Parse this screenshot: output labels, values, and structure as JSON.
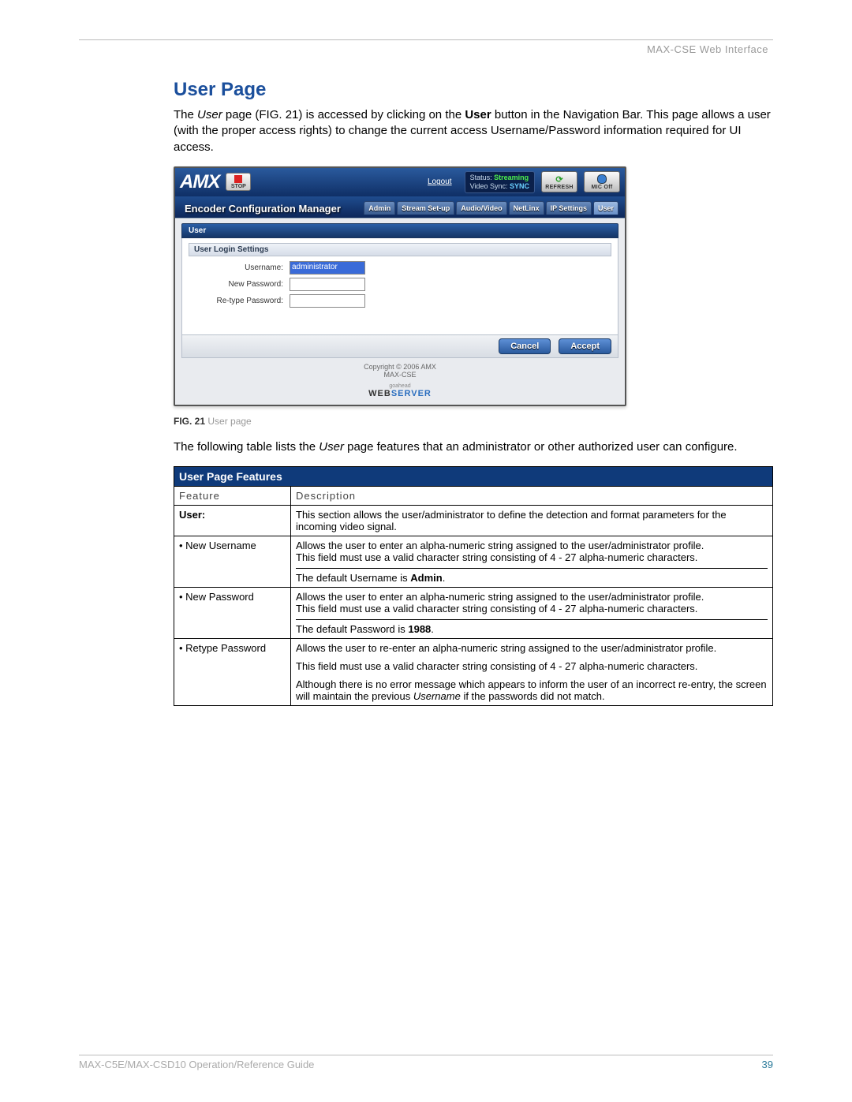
{
  "header": {
    "breadcrumb": "MAX-CSE Web Interface"
  },
  "section": {
    "title": "User Page",
    "intro_a": "The ",
    "intro_user_italic": "User",
    "intro_b": " page (FIG. 21) is accessed by clicking on the ",
    "intro_user_bold": "User",
    "intro_c": " button in the Navigation Bar. This page allows a user (with the proper access rights) to change the current access Username/Password information required for UI access."
  },
  "app": {
    "logo_text": "AMX",
    "stop_label": "STOP",
    "logout": "Logout",
    "status_label": "Status:",
    "status_value": "Streaming",
    "sync_label": "Video Sync:",
    "sync_value": "SYNC",
    "refresh_label": "REFRESH",
    "mic_label": "MIC Off",
    "manager_title": "Encoder Configuration Manager",
    "tabs": [
      "Admin",
      "Stream Set-up",
      "Audio/Video",
      "NetLinx",
      "IP Settings",
      "User"
    ],
    "active_tab_index": 5,
    "panel_title": "User",
    "subpanel_title": "User Login Settings",
    "form": {
      "username_label": "Username:",
      "username_value": "administrator",
      "newpass_label": "New Password:",
      "newpass_value": "",
      "retype_label": "Re-type Password:",
      "retype_value": ""
    },
    "cancel_btn": "Cancel",
    "accept_btn": "Accept",
    "copyright": "Copyright © 2006 AMX",
    "product": "MAX-CSE",
    "go_label": "goahead",
    "web_label": "WEB",
    "server_label": "SERVER"
  },
  "figure": {
    "num": "FIG. 21",
    "caption": "User page"
  },
  "para2_a": "The following table lists the ",
  "para2_user_italic": "User",
  "para2_b": " page features that an administrator or other authorized user can configure.",
  "table": {
    "title": "User Page Features",
    "head_feature": "Feature",
    "head_desc": "Description",
    "rows": [
      {
        "feature": "User:",
        "feature_bold": true,
        "desc_lines": [
          "This section allows the user/administrator to define the detection and format parameters for the incoming video signal."
        ]
      },
      {
        "feature": "• New Username",
        "desc_lines": [
          "Allows the user to enter an alpha-numeric string assigned to the user/administrator profile.",
          "This field must use a valid character string consisting of 4 - 27 alpha-numeric characters."
        ],
        "note_prefix": "The default Username is ",
        "note_bold": "Admin",
        "note_suffix": "."
      },
      {
        "feature": "• New Password",
        "desc_lines": [
          "Allows the user to enter an alpha-numeric string assigned to the user/administrator profile.",
          "This field must use a valid character string consisting of 4 - 27 alpha-numeric characters."
        ],
        "note_prefix": "The default Password is ",
        "note_bold": "1988",
        "note_suffix": "."
      },
      {
        "feature": "• Retype Password",
        "desc_lines": [
          "Allows the user to re-enter an alpha-numeric string assigned to the user/administrator profile.",
          "This field must use a valid character string consisting of 4 - 27 alpha-numeric characters."
        ],
        "extra_prefix": "Although there is no error message which appears to inform the user of an incorrect re-entry, the screen will maintain the previous ",
        "extra_italic": "Username",
        "extra_suffix": " if the passwords did not match."
      }
    ]
  },
  "footer": {
    "guide": "MAX-C5E/MAX-CSD10 Operation/Reference Guide",
    "page_num": "39"
  }
}
